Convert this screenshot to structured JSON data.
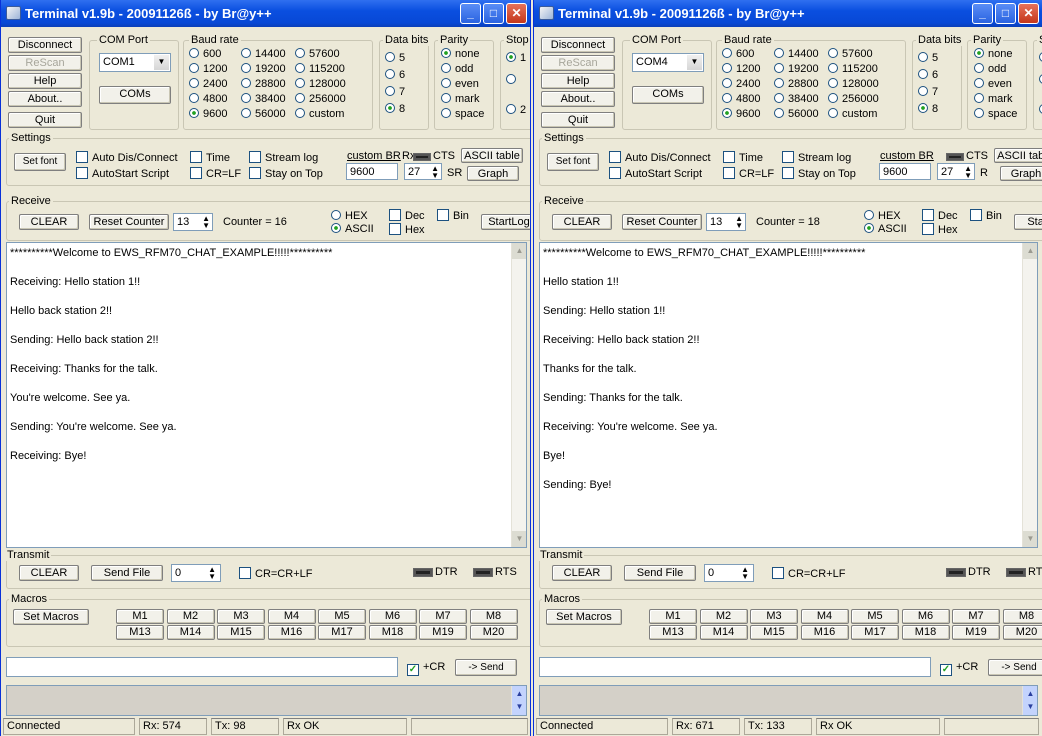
{
  "windows": [
    {
      "title": "Terminal v1.9b - 20091126ß - by Br@y++",
      "buttons": {
        "disconnect": "Disconnect",
        "rescan": "ReScan",
        "help": "Help",
        "about": "About..",
        "quit": "Quit",
        "coms": "COMs"
      },
      "com_port": {
        "label": "COM Port",
        "value": "COM1"
      },
      "baud": {
        "label": "Baud rate",
        "options": [
          "600",
          "1200",
          "2400",
          "4800",
          "9600",
          "14400",
          "19200",
          "28800",
          "38400",
          "56000",
          "57600",
          "115200",
          "128000",
          "256000",
          "custom"
        ],
        "selected": "9600"
      },
      "data_bits": {
        "label": "Data bits",
        "options": [
          "5",
          "6",
          "7",
          "8"
        ],
        "selected": "8"
      },
      "parity": {
        "label": "Parity",
        "options": [
          "none",
          "odd",
          "even",
          "mark",
          "space"
        ],
        "selected": "none"
      },
      "stop": {
        "label": "Stop",
        "options": [
          "1",
          "",
          "2"
        ]
      },
      "settings": {
        "label": "Settings",
        "set_font": "Set font",
        "auto_dis": "Auto Dis/Connect",
        "time": "Time",
        "stream_log": "Stream log",
        "autostart": "AutoStart Script",
        "crlf": "CR=LF",
        "stay_on_top": "Stay on Top",
        "custom_br_label": "custom BR",
        "rx_label": "Rx",
        "custom_br": "9600",
        "rx_val": "27",
        "cts": "CTS",
        "ascii_table": "ASCII table",
        "sr": "SR",
        "graph": "Graph"
      },
      "receive": {
        "label": "Receive",
        "clear": "CLEAR",
        "reset_counter": "Reset Counter",
        "counter_spin": "13",
        "counter_text": "Counter = 16",
        "hex": "HEX",
        "ascii": "ASCII",
        "dec": "Dec",
        "hex_cb": "Hex",
        "bin": "Bin",
        "startlog": "StartLog"
      },
      "lines": [
        "**********Welcome to EWS_RFM70_CHAT_EXAMPLE!!!!!**********",
        "Receiving: Hello station 1!!",
        "Hello back station 2!!",
        "Sending: Hello back station 2!!",
        "Receiving: Thanks for the talk.",
        "You're welcome.  See ya.",
        "Sending: You're welcome.  See ya.",
        "Receiving: Bye!"
      ],
      "transmit": {
        "label": "Transmit",
        "clear": "CLEAR",
        "send_file": "Send File",
        "spin": "0",
        "crcrlf": "CR=CR+LF",
        "dtr": "DTR",
        "rts": "RTS"
      },
      "macros": {
        "label": "Macros",
        "set_macros": "Set Macros",
        "row1": [
          "M1",
          "M2",
          "M3",
          "M4",
          "M5",
          "M6",
          "M7",
          "M8"
        ],
        "row2": [
          "M13",
          "M14",
          "M15",
          "M16",
          "M17",
          "M18",
          "M19",
          "M20"
        ]
      },
      "send": {
        "value": "",
        "cr": "+CR",
        "send": "-> Send"
      },
      "status": {
        "state": "Connected",
        "rx": "Rx: 574",
        "tx": "Tx: 98",
        "rx_ok": "Rx OK"
      }
    },
    {
      "title": "Terminal v1.9b - 20091126ß - by Br@y++",
      "buttons": {
        "disconnect": "Disconnect",
        "rescan": "ReScan",
        "help": "Help",
        "about": "About..",
        "quit": "Quit",
        "coms": "COMs"
      },
      "com_port": {
        "label": "COM Port",
        "value": "COM4"
      },
      "baud": {
        "label": "Baud rate",
        "options": [
          "600",
          "1200",
          "2400",
          "4800",
          "9600",
          "14400",
          "19200",
          "28800",
          "38400",
          "56000",
          "57600",
          "115200",
          "128000",
          "256000",
          "custom"
        ],
        "selected": "9600"
      },
      "data_bits": {
        "label": "Data bits",
        "options": [
          "5",
          "6",
          "7",
          "8"
        ],
        "selected": "8"
      },
      "parity": {
        "label": "Parity",
        "options": [
          "none",
          "odd",
          "even",
          "mark",
          "space"
        ],
        "selected": "none"
      },
      "stop": {
        "label": "St",
        "options": [
          "",
          "",
          ""
        ]
      },
      "settings": {
        "label": "Settings",
        "set_font": "Set font",
        "auto_dis": "Auto Dis/Connect",
        "time": "Time",
        "stream_log": "Stream log",
        "autostart": "AutoStart Script",
        "crlf": "CR=LF",
        "stay_on_top": "Stay on Top",
        "custom_br_label": "custom BR",
        "rx_label": "",
        "custom_br": "9600",
        "rx_val": "27",
        "cts": "CTS",
        "ascii_table": "ASCII table",
        "sr": "R",
        "graph": "Graph"
      },
      "receive": {
        "label": "Receive",
        "clear": "CLEAR",
        "reset_counter": "Reset Counter",
        "counter_spin": "13",
        "counter_text": "Counter = 18",
        "hex": "HEX",
        "ascii": "ASCII",
        "dec": "Dec",
        "hex_cb": "Hex",
        "bin": "Bin",
        "startlog": "StartL"
      },
      "lines": [
        "**********Welcome to EWS_RFM70_CHAT_EXAMPLE!!!!!**********",
        "Hello station 1!!",
        "Sending: Hello station 1!!",
        "Receiving: Hello back station 2!!",
        "Thanks for the talk.",
        "Sending: Thanks for the talk.",
        "Receiving: You're welcome.  See ya.",
        "Bye!",
        "Sending: Bye!"
      ],
      "transmit": {
        "label": "Transmit",
        "clear": "CLEAR",
        "send_file": "Send File",
        "spin": "0",
        "crcrlf": "CR=CR+LF",
        "dtr": "DTR",
        "rts": "RTS"
      },
      "macros": {
        "label": "Macros",
        "set_macros": "Set Macros",
        "row1": [
          "M1",
          "M2",
          "M3",
          "M4",
          "M5",
          "M6",
          "M7",
          "M8"
        ],
        "row2": [
          "M13",
          "M14",
          "M15",
          "M16",
          "M17",
          "M18",
          "M19",
          "M20"
        ]
      },
      "send": {
        "value": "",
        "cr": "+CR",
        "send": "-> Send"
      },
      "status": {
        "state": "Connected",
        "rx": "Rx: 671",
        "tx": "Tx: 133",
        "rx_ok": "Rx OK"
      }
    }
  ]
}
